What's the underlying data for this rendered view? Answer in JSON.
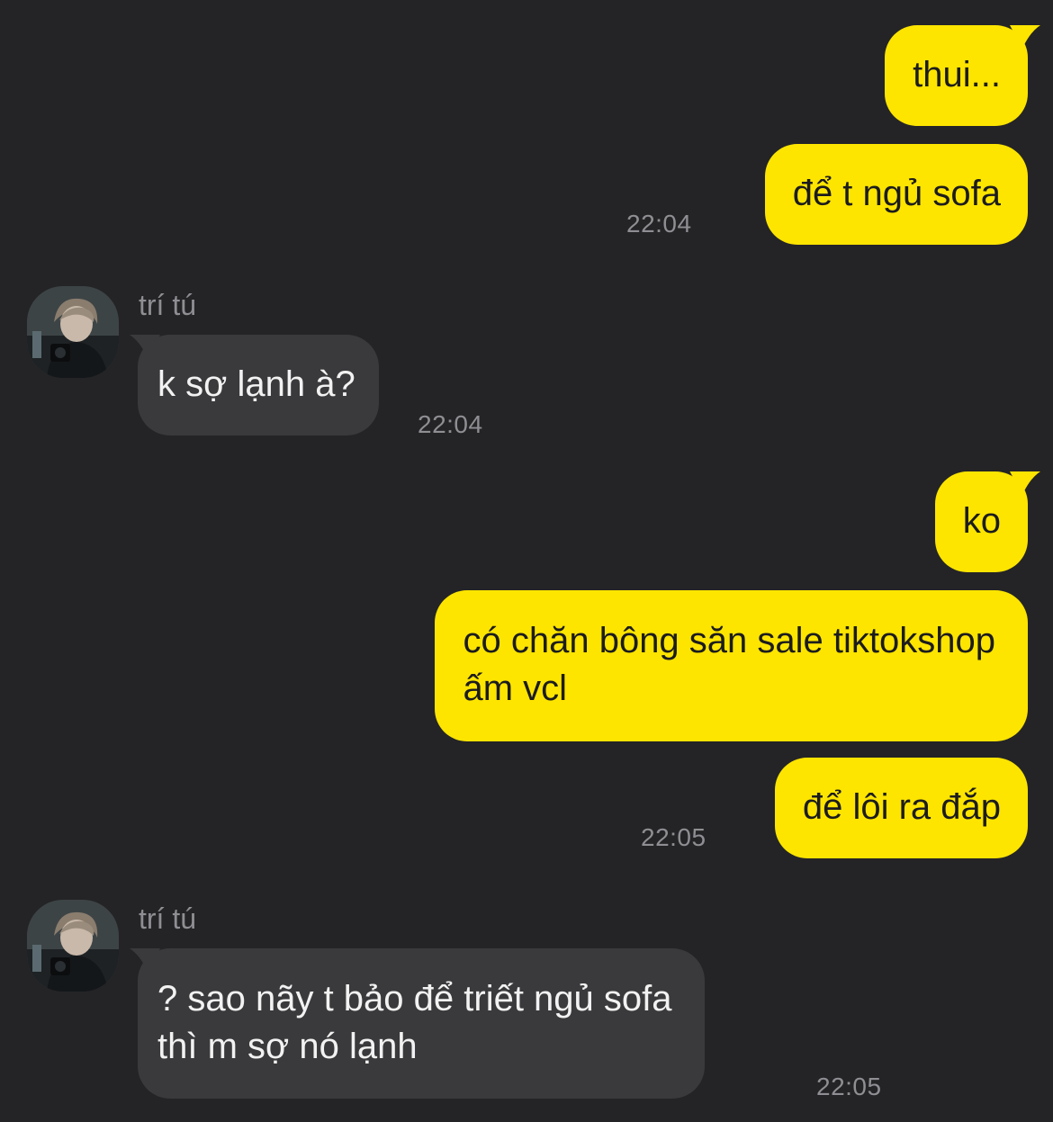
{
  "colors": {
    "background": "#242426",
    "outgoing_bubble": "#fee500",
    "incoming_bubble": "#3a3a3c",
    "timestamp": "#8e8e93"
  },
  "messages": [
    {
      "direction": "outgoing",
      "text": "thui..."
    },
    {
      "direction": "outgoing",
      "text": "để t ngủ sofa",
      "time": "22:04"
    },
    {
      "direction": "incoming",
      "sender": "trí tú",
      "text": "k sợ lạnh à?",
      "time": "22:04"
    },
    {
      "direction": "outgoing",
      "text": "ko"
    },
    {
      "direction": "outgoing",
      "text_lines": [
        "có chăn bông săn sale tiktokshop",
        "ấm vcl"
      ]
    },
    {
      "direction": "outgoing",
      "text": "để lôi ra đắp",
      "time": "22:05"
    },
    {
      "direction": "incoming",
      "sender": "trí tú",
      "text_lines": [
        "? sao nãy t bảo để triết ngủ sofa",
        "thì m sợ nó lạnh"
      ],
      "time": "22:05"
    }
  ],
  "avatar": {
    "icon": "profile-photo"
  }
}
